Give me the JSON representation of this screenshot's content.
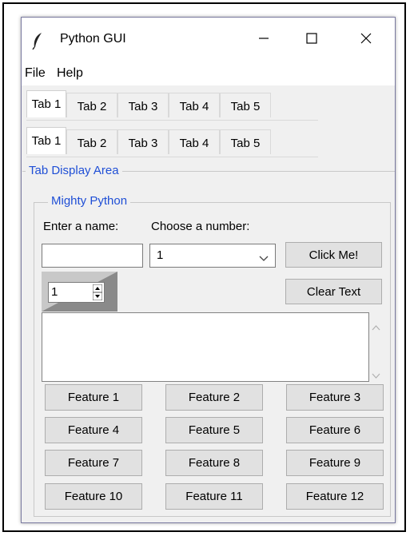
{
  "window": {
    "title": "Python GUI"
  },
  "titlebar_buttons": {
    "minimize": "minimize",
    "maximize": "maximize",
    "close": "close"
  },
  "menu": {
    "items": [
      "File",
      "Help"
    ]
  },
  "tabs_row1": [
    {
      "label": "Tab 1",
      "active": true
    },
    {
      "label": "Tab 2",
      "active": false
    },
    {
      "label": "Tab 3",
      "active": false
    },
    {
      "label": "Tab 4",
      "active": false
    },
    {
      "label": "Tab 5",
      "active": false
    }
  ],
  "tabs_row2": [
    {
      "label": "Tab 1",
      "active": true
    },
    {
      "label": "Tab 2",
      "active": false
    },
    {
      "label": "Tab 3",
      "active": false
    },
    {
      "label": "Tab 4",
      "active": false
    },
    {
      "label": "Tab 5",
      "active": false
    }
  ],
  "display_area": {
    "legend": "Tab Display Area"
  },
  "mighty": {
    "legend": "Mighty Python",
    "name_label": "Enter a name:",
    "name_value": "",
    "number_label": "Choose a number:",
    "number_value": "1",
    "click_button": "Click Me!",
    "clear_button": "Clear Text",
    "spinbox_value": "1",
    "text_value": ""
  },
  "features": [
    "Feature 1",
    "Feature 2",
    "Feature 3",
    "Feature 4",
    "Feature 5",
    "Feature 6",
    "Feature 7",
    "Feature 8",
    "Feature 9",
    "Feature 10",
    "Feature 11",
    "Feature 12"
  ],
  "icons": {
    "app": "feather-icon",
    "minimize": "minimize-icon",
    "maximize": "maximize-icon",
    "close": "close-icon",
    "combo_arrow": "chevron-down-icon",
    "spin": "spin-arrows-icon",
    "scroll_up": "chevron-up-icon",
    "scroll_down": "chevron-down-icon"
  }
}
